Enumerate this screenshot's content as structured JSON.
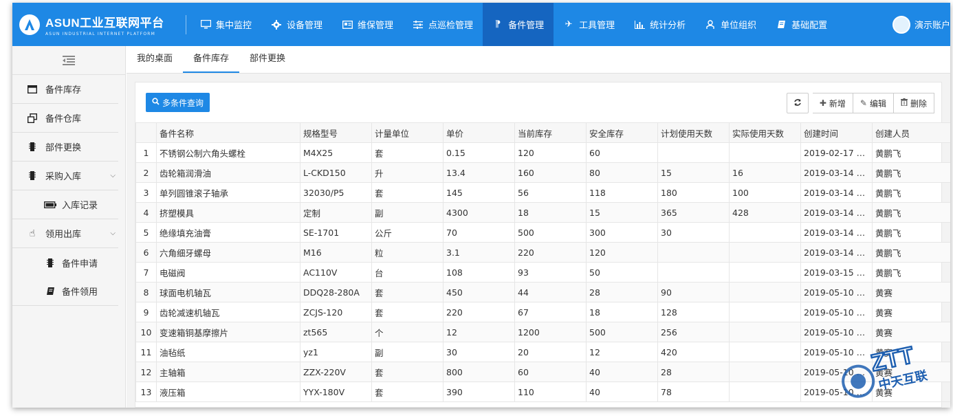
{
  "brand": {
    "title": "ASUN工业互联网平台",
    "subtitle": "ASUN INDUSTRIAL INTERNET PLATFORM"
  },
  "nav": [
    {
      "label": "集中监控",
      "icon": "monitor-icon"
    },
    {
      "label": "设备管理",
      "icon": "gear-icon"
    },
    {
      "label": "维保管理",
      "icon": "card-icon"
    },
    {
      "label": "点巡检管理",
      "icon": "sliders-icon"
    },
    {
      "label": "备件管理",
      "icon": "paragraph-icon",
      "active": true
    },
    {
      "label": "工具管理",
      "icon": "plane-icon"
    },
    {
      "label": "统计分析",
      "icon": "bar-chart-icon"
    },
    {
      "label": "单位组织",
      "icon": "user-icon"
    },
    {
      "label": "基础配置",
      "icon": "book-icon"
    }
  ],
  "user": {
    "name": "演示账户"
  },
  "sidebar": {
    "items": [
      {
        "label": "备件库存",
        "icon": "window-icon"
      },
      {
        "label": "备件仓库",
        "icon": "clone-icon"
      },
      {
        "label": "部件更换",
        "icon": "chip-icon"
      },
      {
        "label": "采购入库",
        "icon": "chip-icon",
        "expandable": true
      },
      {
        "label": "入库记录",
        "icon": "battery-icon",
        "sub": true
      },
      {
        "label": "领用出库",
        "icon": "hand-icon",
        "expandable": true
      },
      {
        "label": "备件申请",
        "icon": "chip-icon",
        "sub": true
      },
      {
        "label": "备件领用",
        "icon": "book-icon",
        "sub": true
      }
    ]
  },
  "tabs": [
    {
      "label": "我的桌面"
    },
    {
      "label": "备件库存",
      "active": true
    },
    {
      "label": "部件更换"
    }
  ],
  "toolbar": {
    "query_label": "多条件查询",
    "add_label": "新增",
    "edit_label": "编辑",
    "delete_label": "删除"
  },
  "table": {
    "columns": [
      "",
      "备件名称",
      "规格型号",
      "计量单位",
      "单价",
      "当前库存",
      "安全库存",
      "计划使用天数",
      "实际使用天数",
      "创建时间",
      "创建人员"
    ],
    "rows": [
      [
        "1",
        "不锈钢公制六角头螺栓",
        "M4X25",
        "套",
        "0.15",
        "120",
        "60",
        "",
        "",
        "2019-02-17 1...",
        "黄鹏飞"
      ],
      [
        "2",
        "齿轮箱润滑油",
        "L-CKD150",
        "升",
        "13.4",
        "160",
        "80",
        "15",
        "16",
        "2019-03-14 1...",
        "黄鹏飞"
      ],
      [
        "3",
        "单列圆锥滚子轴承",
        "32030/P5",
        "套",
        "145",
        "56",
        "118",
        "180",
        "100",
        "2019-03-14 1...",
        "黄鹏飞"
      ],
      [
        "4",
        "挤塑模具",
        "定制",
        "副",
        "4300",
        "18",
        "15",
        "365",
        "428",
        "2019-03-14 1...",
        "黄鹏飞"
      ],
      [
        "5",
        "绝缘填充油膏",
        "SE-1701",
        "公斤",
        "70",
        "500",
        "300",
        "30",
        "",
        "2019-03-14 1...",
        "黄鹏飞"
      ],
      [
        "6",
        "六角细牙螺母",
        "M16",
        "粒",
        "3.1",
        "220",
        "120",
        "",
        "",
        "2019-03-14 1...",
        "黄鹏飞"
      ],
      [
        "7",
        "电磁阀",
        "AC110V",
        "台",
        "108",
        "93",
        "50",
        "",
        "",
        "2019-03-15 1...",
        "黄鹏飞"
      ],
      [
        "8",
        "球面电机轴瓦",
        "DDQ28-280A",
        "套",
        "450",
        "44",
        "28",
        "90",
        "",
        "2019-05-10 0...",
        "黄赛"
      ],
      [
        "9",
        "齿轮减速机轴瓦",
        "ZCJS-120",
        "套",
        "220",
        "67",
        "18",
        "128",
        "",
        "2019-05-10 0...",
        "黄赛"
      ],
      [
        "10",
        "变速箱铜基摩擦片",
        "zt565",
        "个",
        "12",
        "1200",
        "500",
        "256",
        "",
        "2019-05-10 0...",
        "黄赛"
      ],
      [
        "11",
        "油毡纸",
        "yz1",
        "副",
        "30",
        "20",
        "12",
        "420",
        "",
        "2019-05-10 0...",
        "黄赛"
      ],
      [
        "12",
        "主轴箱",
        "ZZX-220V",
        "套",
        "800",
        "60",
        "40",
        "28",
        "",
        "2019-05-10 0...",
        "黄赛"
      ],
      [
        "13",
        "液压箱",
        "YYX-180V",
        "套",
        "390",
        "110",
        "40",
        "78",
        "",
        "2019-05-10 0...",
        "黄赛"
      ]
    ]
  },
  "watermark": {
    "brand": "ZTT",
    "name": "中天互联"
  },
  "colors": {
    "primary": "#1e88e5",
    "primary_dark": "#1565c0"
  }
}
